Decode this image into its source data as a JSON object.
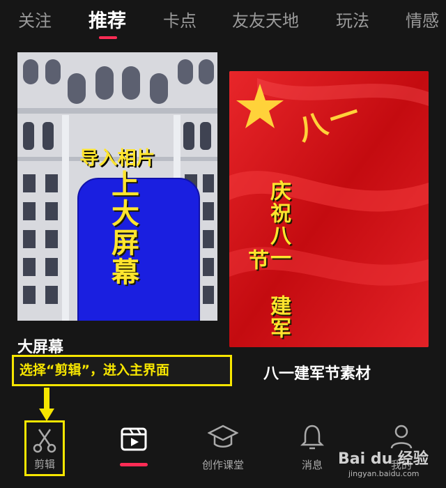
{
  "tabs": [
    {
      "label": "关注",
      "active": false
    },
    {
      "label": "推荐",
      "active": true
    },
    {
      "label": "卡点",
      "active": false
    },
    {
      "label": "友友天地",
      "active": false
    },
    {
      "label": "玩法",
      "active": false
    },
    {
      "label": "情感",
      "active": false
    }
  ],
  "cards": [
    {
      "title_text": "导入相片",
      "big_text": "上大屏幕",
      "caption": "大屏幕"
    },
    {
      "vertical_text": "庆祝八一 建军节",
      "flag_text": "八一",
      "caption": "八一建军节素材"
    }
  ],
  "annotation": {
    "text": "选择“剪辑”，进入主界面",
    "color": "#f7e600"
  },
  "nav": [
    {
      "label": "剪辑",
      "icon": "scissors-icon"
    },
    {
      "label": "",
      "icon": "clapperboard-play-icon",
      "active": true
    },
    {
      "label": "创作课堂",
      "icon": "graduation-cap-icon"
    },
    {
      "label": "消息",
      "icon": "bell-icon"
    },
    {
      "label": "我的",
      "icon": "person-icon"
    }
  ],
  "watermark": {
    "text": "Bai du 经验",
    "sub": "jingyan.baidu.com"
  },
  "colors": {
    "accent": "#fe2c55",
    "annotation": "#f7e600",
    "background": "#161616"
  }
}
